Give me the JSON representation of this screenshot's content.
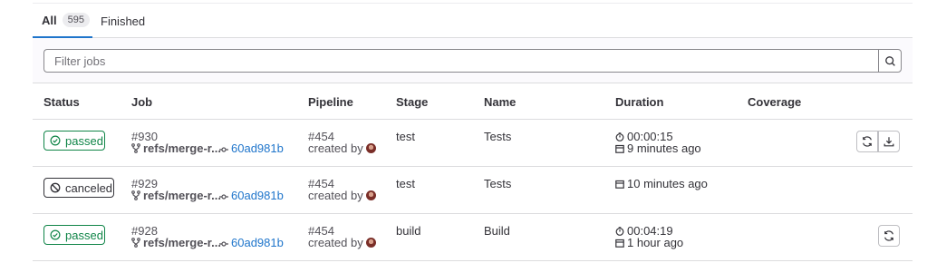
{
  "tabs": [
    {
      "label": "All",
      "count": "595"
    },
    {
      "label": "Finished"
    }
  ],
  "filter": {
    "placeholder": "Filter jobs"
  },
  "columns": [
    "Status",
    "Job",
    "Pipeline",
    "Stage",
    "Name",
    "Duration",
    "Coverage"
  ],
  "jobs": [
    {
      "status": "passed",
      "job_id": "#930",
      "ref": "refs/merge-r...",
      "commit": "60ad981b",
      "pipeline": "#454",
      "created_by": "created by",
      "stage": "test",
      "name": "Tests",
      "duration": "00:00:15",
      "finished": "9 minutes ago"
    },
    {
      "status": "canceled",
      "job_id": "#929",
      "ref": "refs/merge-r...",
      "commit": "60ad981b",
      "pipeline": "#454",
      "created_by": "created by",
      "stage": "test",
      "name": "Tests",
      "finished": "10 minutes ago"
    },
    {
      "status": "passed",
      "job_id": "#928",
      "ref": "refs/merge-r...",
      "commit": "60ad981b",
      "pipeline": "#454",
      "created_by": "created by",
      "stage": "build",
      "name": "Build",
      "duration": "00:04:19",
      "finished": "1 hour ago"
    }
  ],
  "colors": {
    "accent": "#1f75cb",
    "success": "#108548",
    "canceled": "#333238",
    "border": "#dcdcde"
  },
  "icons": {
    "search": "search-icon",
    "retry": "retry-icon",
    "download": "download-icon",
    "branch": "branch-icon",
    "commit": "commit-icon",
    "timer": "timer-icon",
    "calendar": "calendar-icon",
    "passed": "status-passed-icon",
    "canceled": "status-canceled-icon"
  }
}
